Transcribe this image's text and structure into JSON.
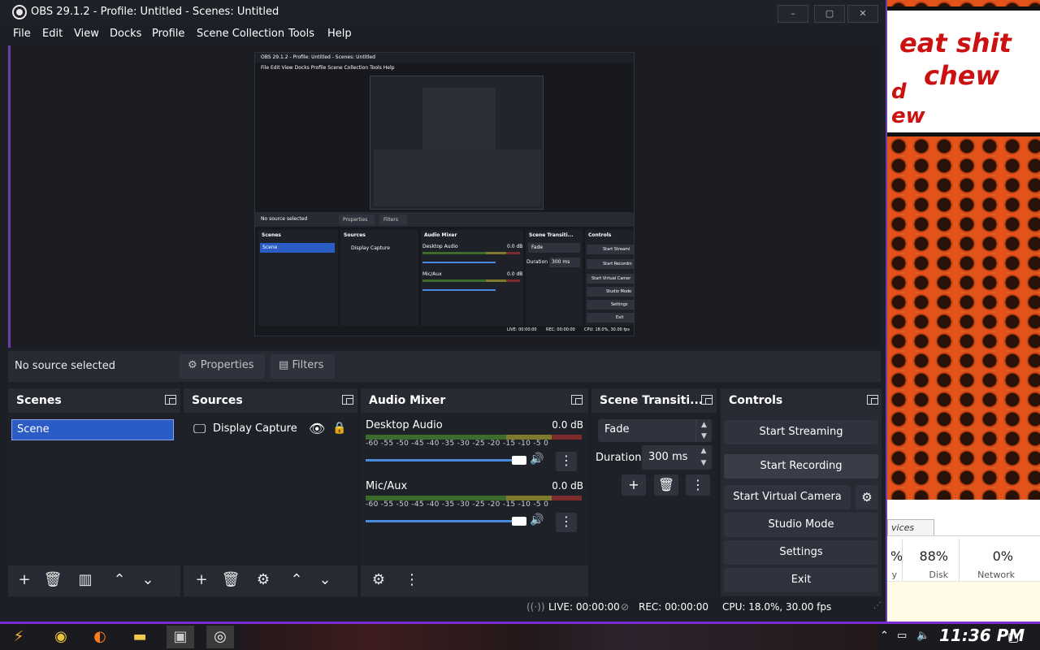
{
  "window": {
    "title": "OBS 29.1.2 - Profile: Untitled - Scenes: Untitled",
    "minimize": "–",
    "maximize": "▢",
    "close": "✕"
  },
  "menu": [
    "File",
    "Edit",
    "View",
    "Docks",
    "Profile",
    "Scene Collection",
    "Tools",
    "Help"
  ],
  "preview": {
    "nested_title": "OBS 29.1.2 - Profile: Untitled - Scenes: Untitled",
    "nested_menu": "File  Edit  View  Docks  Profile  Scene Collection  Tools  Help",
    "nested_no_source": "No source selected",
    "nested_properties": "Properties",
    "nested_filters": "Filters",
    "nested_scenes": "Scenes",
    "nested_sources": "Sources",
    "nested_mixer": "Audio Mixer",
    "nested_transitions": "Scene Transiti...",
    "nested_controls": "Controls",
    "nested_scene": "Scene",
    "nested_display": "Display Capture",
    "nested_desktop": "Desktop Audio",
    "nested_mic": "Mic/Aux",
    "nested_db": "0.0 dB",
    "nested_fade": "Fade",
    "nested_duration": "Duration",
    "nested_ms": "300 ms",
    "nested_controls_list": [
      "Start Streami",
      "Start Recordin",
      "Start Virtual Camer",
      "Studio Mode",
      "Settings",
      "Exit"
    ],
    "nested_live": "LIVE: 00:00:00",
    "nested_rec": "REC: 00:00:00",
    "nested_cpu": "CPU: 18.0%, 30.00 fps"
  },
  "source_toolbar": {
    "no_source": "No source selected",
    "properties": "Properties",
    "filters": "Filters"
  },
  "scenes": {
    "title": "Scenes",
    "items": [
      "Scene"
    ]
  },
  "sources": {
    "title": "Sources",
    "items": [
      "Display Capture"
    ]
  },
  "mixer": {
    "title": "Audio Mixer",
    "channels": [
      {
        "name": "Desktop Audio",
        "db": "0.0 dB"
      },
      {
        "name": "Mic/Aux",
        "db": "0.0 dB"
      }
    ],
    "scale": "-60 -55 -50 -45 -40 -35 -30 -25 -20 -15 -10 -5 0"
  },
  "transitions": {
    "title": "Scene Transiti...",
    "type": "Fade",
    "duration_label": "Duration",
    "duration": "300 ms"
  },
  "controls": {
    "title": "Controls",
    "start_streaming": "Start Streaming",
    "start_recording": "Start Recording",
    "start_virtual_camera": "Start Virtual Camera",
    "studio_mode": "Studio Mode",
    "settings": "Settings",
    "exit": "Exit"
  },
  "status": {
    "live": "LIVE: 00:00:00",
    "rec": "REC: 00:00:00",
    "cpu": "CPU: 18.0%, 30.00 fps"
  },
  "background": {
    "bubble_lines": [
      "eat shit",
      "chew",
      "d",
      "ew"
    ],
    "taskmgr_tab": "vices",
    "stats": [
      {
        "value": "%",
        "label": "y"
      },
      {
        "value": "88%",
        "label": "Disk"
      },
      {
        "value": "0%",
        "label": "Network"
      }
    ]
  },
  "taskbar": {
    "clock": "11:36 PM"
  },
  "colors": {
    "accent": "#6a3da8",
    "selection": "#2b5bc5",
    "panel": "#272a33"
  }
}
